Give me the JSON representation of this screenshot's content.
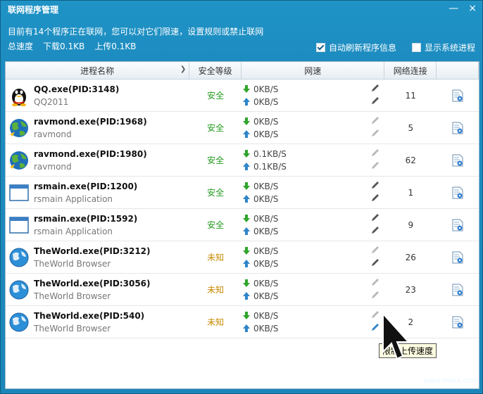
{
  "window": {
    "title": "联网程序管理",
    "minimize": "—",
    "close": "×"
  },
  "info": {
    "line1": "目前有14个程序正在联网，您可以对它们限速，设置规则或禁止联网",
    "total_label": "总速度",
    "down_label": "下载0.1KB",
    "up_label": "上传0.1KB"
  },
  "options": [
    {
      "label": "自动刷新程序信息",
      "checked": true
    },
    {
      "label": "显示系统进程",
      "checked": false
    }
  ],
  "columns": {
    "name": "进程名称",
    "security": "安全等级",
    "speed": "网速",
    "connections": "网络连接"
  },
  "rows": [
    {
      "name": "QQ.exe(PID:3148)",
      "sub": "QQ2011",
      "icon": "qq-penguin-icon",
      "security": "安全",
      "sec_type": "safe",
      "down": "0KB/S",
      "up": "0KB/S",
      "conn": "11"
    },
    {
      "name": "ravmond.exe(PID:1968)",
      "sub": "ravmond",
      "icon": "ravmond-globe-icon",
      "security": "安全",
      "sec_type": "safe",
      "down": "0KB/S",
      "up": "0KB/S",
      "conn": "5"
    },
    {
      "name": "ravmond.exe(PID:1980)",
      "sub": "ravmond",
      "icon": "ravmond-globe-icon",
      "security": "安全",
      "sec_type": "safe",
      "down": "0.1KB/S",
      "up": "0.1KB/S",
      "conn": "62"
    },
    {
      "name": "rsmain.exe(PID:1200)",
      "sub": "rsmain Application",
      "icon": "app-window-icon",
      "security": "安全",
      "sec_type": "safe",
      "down": "0KB/S",
      "up": "0KB/S",
      "conn": "1"
    },
    {
      "name": "rsmain.exe(PID:1592)",
      "sub": "rsmain Application",
      "icon": "app-window-icon",
      "security": "安全",
      "sec_type": "safe",
      "down": "0KB/S",
      "up": "0KB/S",
      "conn": "9"
    },
    {
      "name": "TheWorld.exe(PID:3212)",
      "sub": "TheWorld Browser",
      "icon": "theworld-globe-icon",
      "security": "未知",
      "sec_type": "unknown",
      "down": "0KB/S",
      "up": "0KB/S",
      "conn": "26"
    },
    {
      "name": "TheWorld.exe(PID:3056)",
      "sub": "TheWorld Browser",
      "icon": "theworld-globe-icon",
      "security": "未知",
      "sec_type": "unknown",
      "down": "0KB/S",
      "up": "0KB/S",
      "conn": "23"
    },
    {
      "name": "TheWorld.exe(PID:540)",
      "sub": "TheWorld Browser",
      "icon": "theworld-globe-icon",
      "security": "未知",
      "sec_type": "unknown",
      "down": "0KB/S",
      "up": "0KB/S",
      "conn": "2"
    }
  ],
  "tooltip": "限制上传速度",
  "watermark": {
    "brand": "瑞星卡卡",
    "url": "www.ikaka.com"
  },
  "colors": {
    "title_bg": "#1d8cc0",
    "safe": "#239a1f",
    "unknown": "#c98a00"
  }
}
